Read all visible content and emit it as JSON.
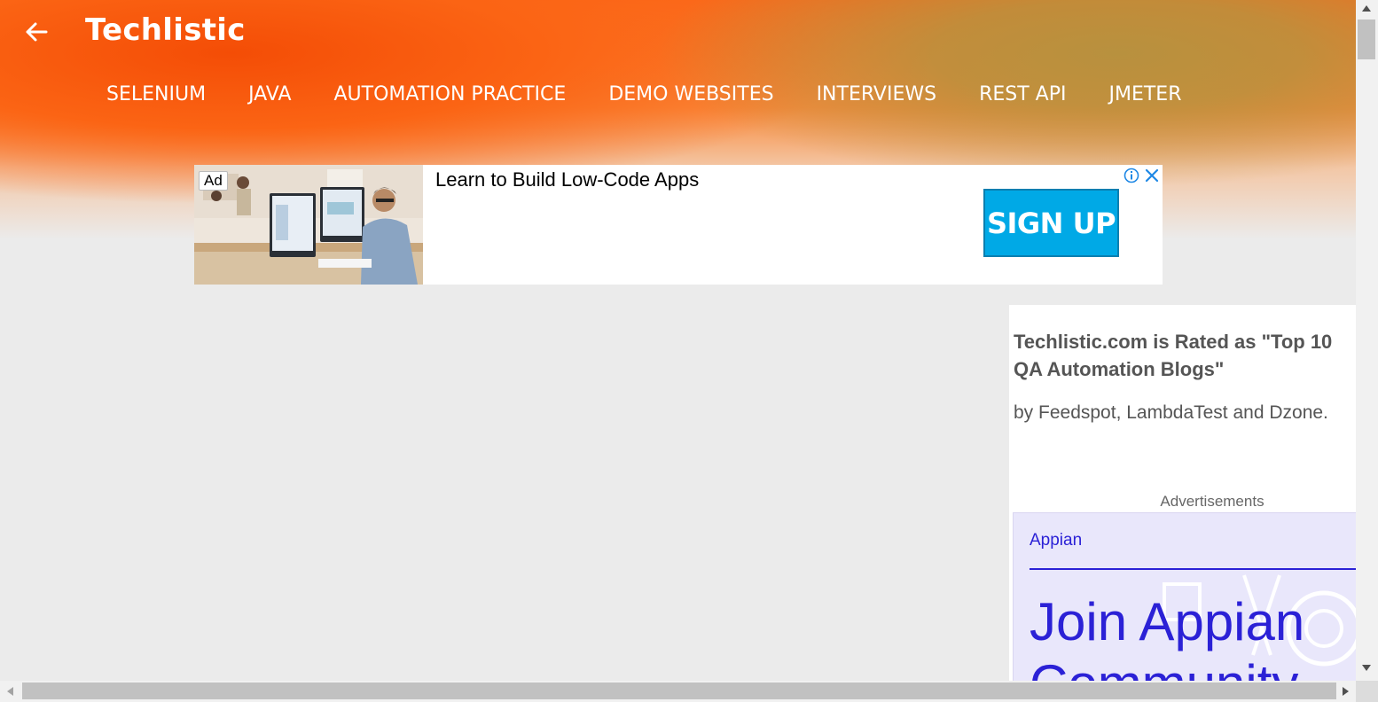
{
  "header": {
    "brand": "Techlistic",
    "nav": [
      "SELENIUM",
      "JAVA",
      "AUTOMATION PRACTICE",
      "DEMO WEBSITES",
      "INTERVIEWS",
      "REST API",
      "JMETER"
    ]
  },
  "ad_banner": {
    "tag": "Ad",
    "headline": "Learn to Build Low-Code Apps",
    "cta": "SIGN UP"
  },
  "sidebar": {
    "rated": "Techlistic.com is Rated as \"Top 10 QA Automation Blogs\"",
    "byline": "by Feedspot, LambdaTest and Dzone.",
    "ads_label": "Advertisements",
    "appian_ad": {
      "brand": "Appian",
      "headline_line1": "Join Appian",
      "headline_line2": "Community"
    }
  },
  "colors": {
    "accent_orange": "#fb6414",
    "appian_blue": "#2b21d6",
    "signup_blue": "#00a9e6"
  }
}
